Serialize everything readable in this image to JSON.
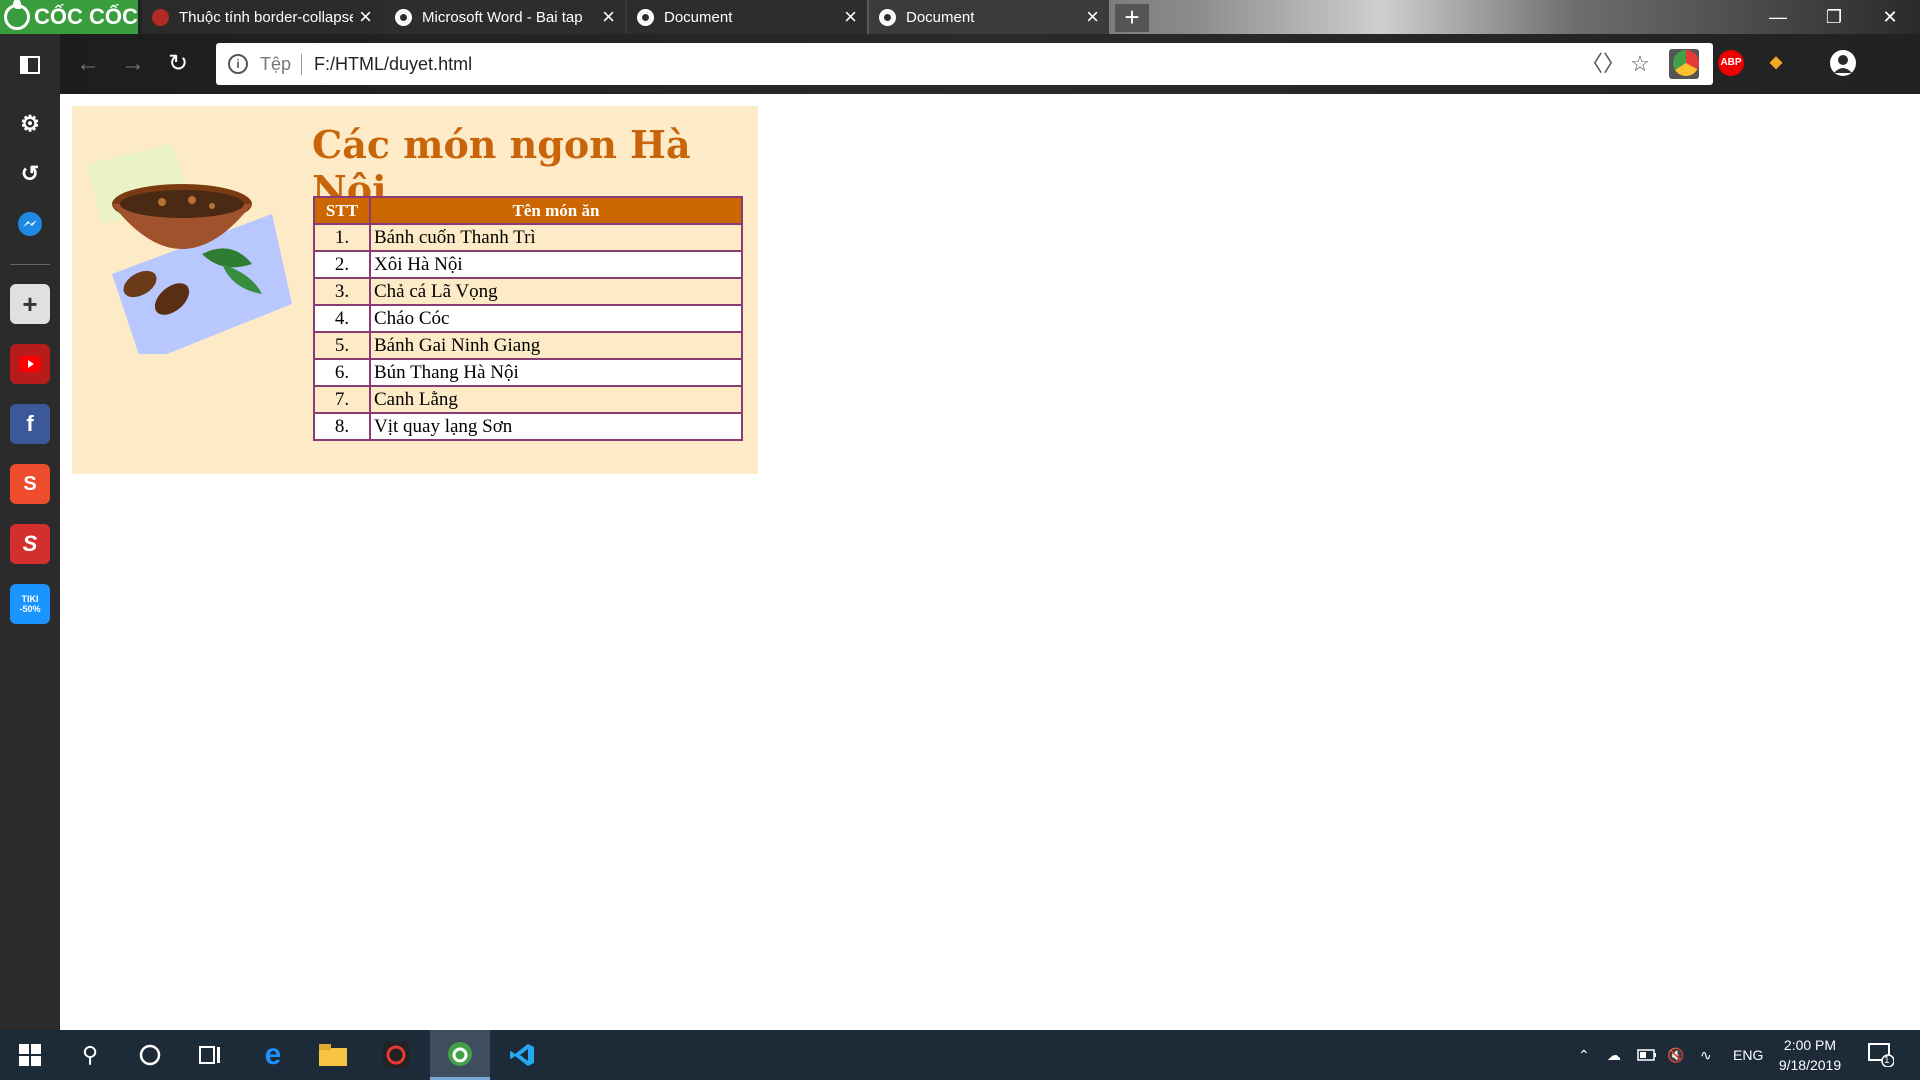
{
  "browser": {
    "brand": "CỐC CỐC",
    "tabs": [
      {
        "title": "Thuộc tính border-collapse"
      },
      {
        "title": "Microsoft Word - Bai tap"
      },
      {
        "title": "Document"
      },
      {
        "title": "Document"
      }
    ],
    "new_tab_label": "+",
    "scheme_label": "Tệp",
    "url": "F:/HTML/duyet.html",
    "extensions": {
      "abp": "ABP"
    }
  },
  "page": {
    "title": "Các món ngon Hà Nội",
    "table": {
      "headers": [
        "STT",
        "Tên món ăn"
      ],
      "rows": [
        [
          "1.",
          "Bánh cuốn Thanh Trì"
        ],
        [
          "2.",
          "Xôi Hà Nội"
        ],
        [
          "3.",
          "Chả cá Lã Vọng"
        ],
        [
          "4.",
          "Cháo Cóc"
        ],
        [
          "5.",
          "Bánh Gai Ninh Giang"
        ],
        [
          "6.",
          "Bún Thang Hà Nội"
        ],
        [
          "7.",
          "Canh Lằng"
        ],
        [
          "8.",
          "Vịt quay lạng Sơn"
        ]
      ]
    }
  },
  "sidebar": {
    "tiki_label": "TIKI -50%"
  },
  "taskbar": {
    "language": "ENG",
    "time": "2:00 PM",
    "date": "9/18/2019",
    "notification_count": "1"
  },
  "colors": {
    "card_bg": "#fdebc8",
    "title": "#c8650a",
    "table_header": "#cc6600",
    "table_border": "#8b3b74"
  }
}
